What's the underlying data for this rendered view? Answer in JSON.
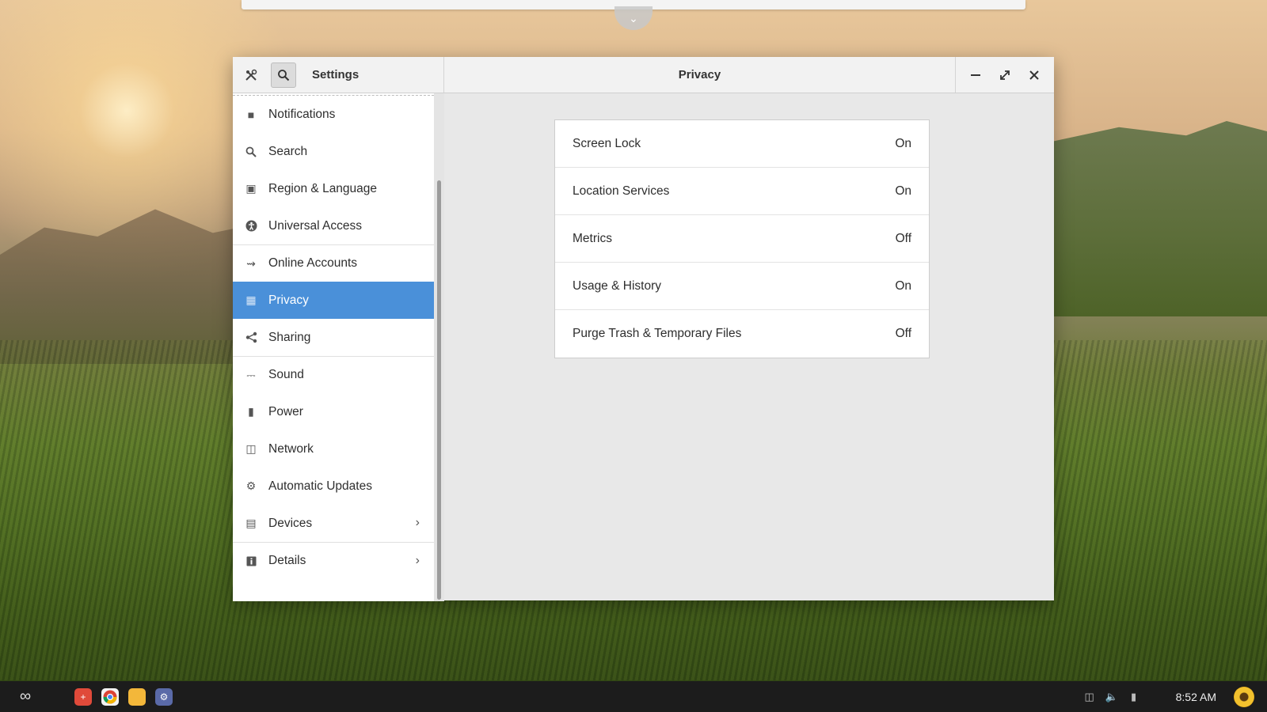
{
  "window": {
    "app_title": "Settings",
    "page_title": "Privacy"
  },
  "sidebar": {
    "items": [
      {
        "label": "Notifications",
        "icon": "notifications-icon"
      },
      {
        "label": "Search",
        "icon": "search-icon"
      },
      {
        "label": "Region & Language",
        "icon": "region-icon"
      },
      {
        "label": "Universal Access",
        "icon": "accessibility-icon"
      },
      {
        "label": "Online Accounts",
        "icon": "online-accounts-icon"
      },
      {
        "label": "Privacy",
        "icon": "privacy-icon",
        "active": true
      },
      {
        "label": "Sharing",
        "icon": "share-icon"
      },
      {
        "label": "Sound",
        "icon": "sound-icon"
      },
      {
        "label": "Power",
        "icon": "power-icon"
      },
      {
        "label": "Network",
        "icon": "network-icon"
      },
      {
        "label": "Automatic Updates",
        "icon": "gear-icon"
      },
      {
        "label": "Devices",
        "icon": "devices-icon"
      },
      {
        "label": "Details",
        "icon": "info-icon"
      }
    ]
  },
  "privacy": {
    "rows": [
      {
        "label": "Screen Lock",
        "value": "On"
      },
      {
        "label": "Location Services",
        "value": "On"
      },
      {
        "label": "Metrics",
        "value": "Off"
      },
      {
        "label": "Usage & History",
        "value": "On"
      },
      {
        "label": "Purge Trash & Temporary Files",
        "value": "Off"
      }
    ]
  },
  "taskbar": {
    "clock": "8:52 AM"
  },
  "colors": {
    "accent": "#4a90d9",
    "taskbar": "#1c1c1c"
  }
}
